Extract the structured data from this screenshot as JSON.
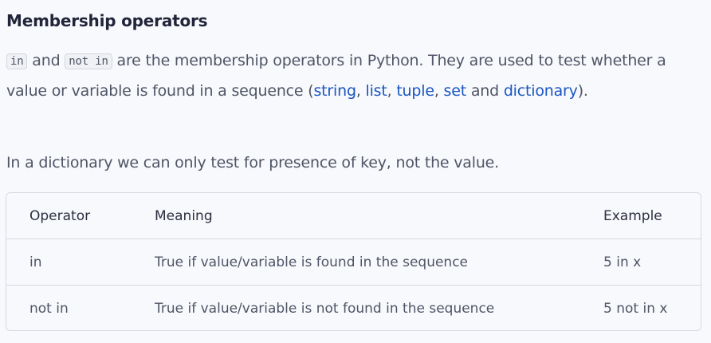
{
  "heading": "Membership operators",
  "intro": {
    "code_in": "in",
    "text_and": " and ",
    "code_not_in": "not in",
    "text_1": " are the membership operators in Python. They are used to test whether a value or variable is found in a sequence (",
    "link_string": "string",
    "sep_1": ", ",
    "link_list": "list",
    "sep_2": ", ",
    "link_tuple": "tuple",
    "sep_3": ", ",
    "link_set": "set",
    "text_and_2": " and ",
    "link_dictionary": "dictionary",
    "text_end": ")."
  },
  "note": "In a dictionary we can only test for presence of key, not the value.",
  "table": {
    "headers": [
      "Operator",
      "Meaning",
      "Example"
    ],
    "rows": [
      [
        "in",
        "True if value/variable is found in the sequence",
        "5 in x"
      ],
      [
        "not in",
        "True if value/variable is not found in the sequence",
        "5 not in x"
      ]
    ]
  },
  "colors": {
    "link": "#1a56c2",
    "heading": "#22253a",
    "body_text": "#4f5566"
  }
}
